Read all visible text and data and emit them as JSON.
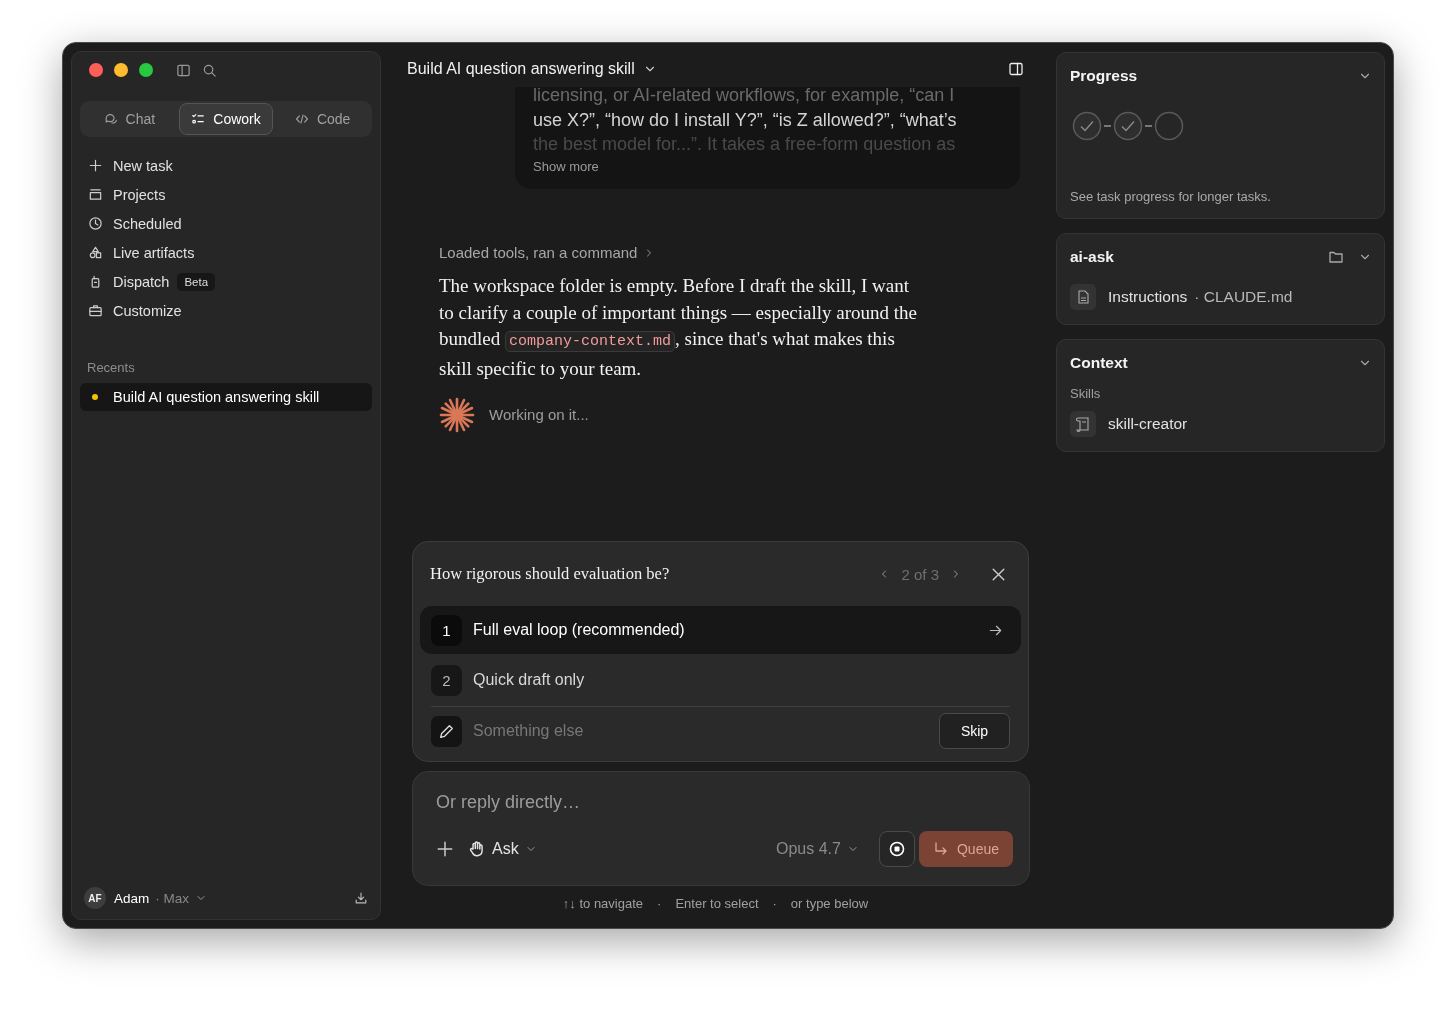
{
  "sidebar": {
    "tabs": [
      {
        "label": "Chat",
        "selected": false
      },
      {
        "label": "Cowork",
        "selected": true
      },
      {
        "label": "Code",
        "selected": false
      }
    ],
    "nav": [
      {
        "label": "New task"
      },
      {
        "label": "Projects"
      },
      {
        "label": "Scheduled"
      },
      {
        "label": "Live artifacts"
      },
      {
        "label": "Dispatch",
        "badge": "Beta"
      },
      {
        "label": "Customize"
      }
    ],
    "recents": {
      "title": "Recents",
      "items": [
        {
          "label": "Build AI question answering skill",
          "selected": true,
          "color": "#f5c400"
        }
      ]
    },
    "user": {
      "initials": "AF",
      "name": "Adam",
      "plan": "· Max"
    }
  },
  "header": {
    "title": "Build AI question answering skill"
  },
  "prompt_card": {
    "lines": [
      "licensing, or AI-related workflows, for example, “can I",
      "use X?”, “how do I install Y?”, “is Z allowed?”, “what’s",
      "the best model for...”. It takes a free-form question as"
    ],
    "show_more": "Show more"
  },
  "tool_summary": "Loaded tools, ran a command",
  "message": {
    "before": "The workspace folder is empty. Before I draft the skill, I want to clarify a couple of important things — especially around the bundled",
    "code": "company-context.md",
    "after": ", since that's what makes this skill specific to your team."
  },
  "status": "Working on it...",
  "question": {
    "title": "How rigorous should evaluation be?",
    "pager": "2 of 3",
    "options": [
      {
        "number": "1",
        "label": "Full eval loop (recommended)",
        "selected": true
      },
      {
        "number": "2",
        "label": "Quick draft only",
        "selected": false
      }
    ],
    "other": {
      "placeholder": "Something else"
    },
    "skip": "Skip"
  },
  "composer": {
    "placeholder": "Or reply directly…",
    "mode": "Ask",
    "model": "Opus 4.7",
    "queue": "Queue"
  },
  "hints": [
    "↑↓ to navigate",
    "·",
    "Enter to select",
    "·",
    "or type below"
  ],
  "progress": {
    "title": "Progress",
    "steps": [
      {
        "done": true
      },
      {
        "done": true
      },
      {
        "done": false
      }
    ],
    "note": "See task progress for longer tasks."
  },
  "project": {
    "title": "ai-ask",
    "files": [
      {
        "name": "Instructions",
        "detail": "· CLAUDE.md"
      }
    ]
  },
  "context": {
    "title": "Context",
    "section": "Skills",
    "skills": [
      "skill-creator"
    ]
  }
}
